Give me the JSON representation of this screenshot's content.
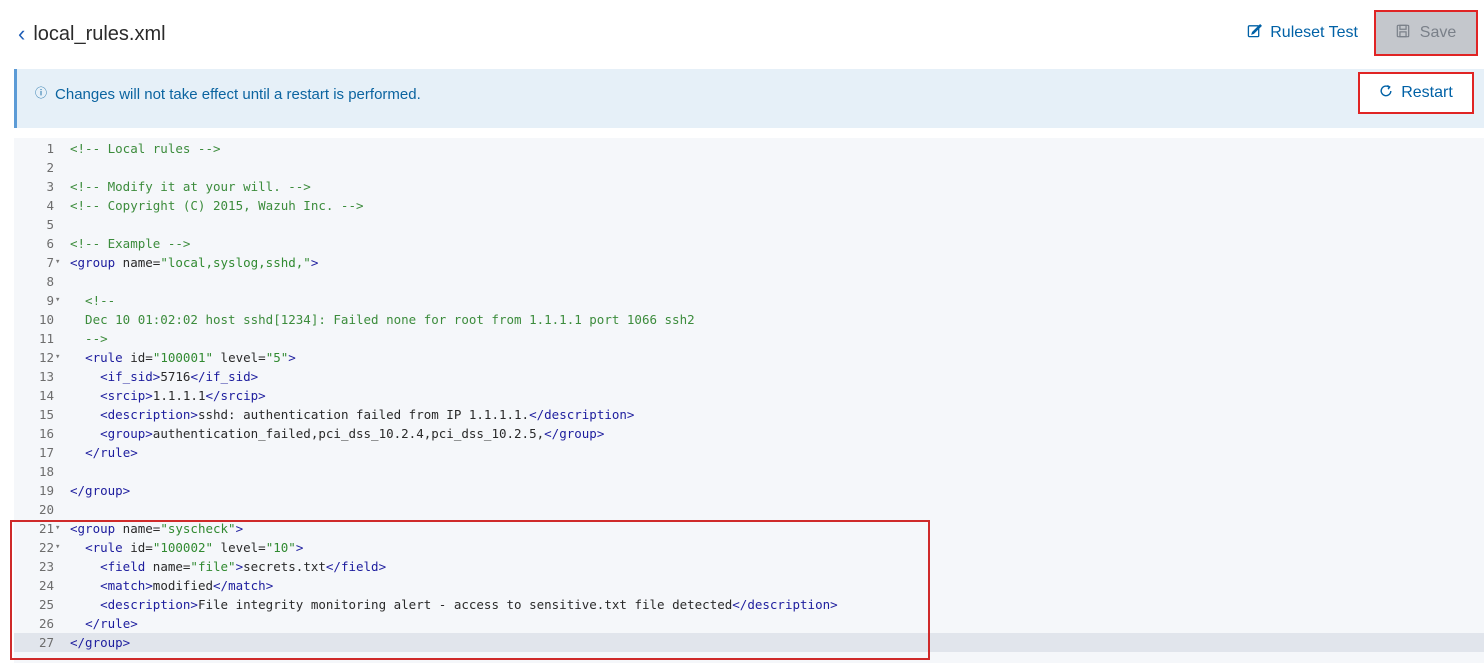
{
  "header": {
    "back_label": "local_rules.xml",
    "ruleset_test_label": "Ruleset Test",
    "save_label": "Save"
  },
  "callout": {
    "message": "Changes will not take effect until a restart is performed.",
    "restart_label": "Restart"
  },
  "icons": {
    "back": "chevron-left-icon",
    "ruleset_test": "edit-icon",
    "save": "save-icon",
    "info": "info-icon",
    "restart": "refresh-icon"
  },
  "colors": {
    "accent": "#0061a6",
    "callout_bg": "#e6f0f8",
    "highlight_border": "#cf2a2a",
    "editor_bg": "#f5f7fa",
    "comment": "#3c8c3c",
    "tag": "#1d1d9e",
    "string": "#318a31"
  },
  "editor": {
    "active_line": 27,
    "lines": [
      {
        "n": "1",
        "fold": false,
        "code": [
          {
            "t": "comment",
            "v": "<!-- Local rules -->"
          }
        ]
      },
      {
        "n": "2",
        "fold": false,
        "code": []
      },
      {
        "n": "3",
        "fold": false,
        "code": [
          {
            "t": "comment",
            "v": "<!-- Modify it at your will. -->"
          }
        ]
      },
      {
        "n": "4",
        "fold": false,
        "code": [
          {
            "t": "comment",
            "v": "<!-- Copyright (C) 2015, Wazuh Inc. -->"
          }
        ]
      },
      {
        "n": "5",
        "fold": false,
        "code": []
      },
      {
        "n": "6",
        "fold": false,
        "code": [
          {
            "t": "comment",
            "v": "<!-- Example -->"
          }
        ]
      },
      {
        "n": "7",
        "fold": true,
        "code": [
          {
            "t": "tag",
            "v": "<group"
          },
          {
            "t": "attr",
            "v": " name="
          },
          {
            "t": "str",
            "v": "\"local,syslog,sshd,\""
          },
          {
            "t": "tag",
            "v": ">"
          }
        ]
      },
      {
        "n": "8",
        "fold": false,
        "code": []
      },
      {
        "n": "9",
        "fold": true,
        "code": [
          {
            "t": "comment",
            "v": "  <!--"
          }
        ]
      },
      {
        "n": "10",
        "fold": false,
        "code": [
          {
            "t": "comment",
            "v": "  Dec 10 01:02:02 host sshd[1234]: Failed none for root from 1.1.1.1 port 1066 ssh2"
          }
        ]
      },
      {
        "n": "11",
        "fold": false,
        "code": [
          {
            "t": "comment",
            "v": "  -->"
          }
        ]
      },
      {
        "n": "12",
        "fold": true,
        "code": [
          {
            "t": "text",
            "v": "  "
          },
          {
            "t": "tag",
            "v": "<rule"
          },
          {
            "t": "attr",
            "v": " id="
          },
          {
            "t": "str",
            "v": "\"100001\""
          },
          {
            "t": "attr",
            "v": " level="
          },
          {
            "t": "str",
            "v": "\"5\""
          },
          {
            "t": "tag",
            "v": ">"
          }
        ]
      },
      {
        "n": "13",
        "fold": false,
        "code": [
          {
            "t": "text",
            "v": "    "
          },
          {
            "t": "tag",
            "v": "<if_sid>"
          },
          {
            "t": "text",
            "v": "5716"
          },
          {
            "t": "tag",
            "v": "</if_sid>"
          }
        ]
      },
      {
        "n": "14",
        "fold": false,
        "code": [
          {
            "t": "text",
            "v": "    "
          },
          {
            "t": "tag",
            "v": "<srcip>"
          },
          {
            "t": "text",
            "v": "1.1.1.1"
          },
          {
            "t": "tag",
            "v": "</srcip>"
          }
        ]
      },
      {
        "n": "15",
        "fold": false,
        "code": [
          {
            "t": "text",
            "v": "    "
          },
          {
            "t": "tag",
            "v": "<description>"
          },
          {
            "t": "text",
            "v": "sshd: authentication failed from IP 1.1.1.1."
          },
          {
            "t": "tag",
            "v": "</description>"
          }
        ]
      },
      {
        "n": "16",
        "fold": false,
        "code": [
          {
            "t": "text",
            "v": "    "
          },
          {
            "t": "tag",
            "v": "<group>"
          },
          {
            "t": "text",
            "v": "authentication_failed,pci_dss_10.2.4,pci_dss_10.2.5,"
          },
          {
            "t": "tag",
            "v": "</group>"
          }
        ]
      },
      {
        "n": "17",
        "fold": false,
        "code": [
          {
            "t": "text",
            "v": "  "
          },
          {
            "t": "tag",
            "v": "</rule>"
          }
        ]
      },
      {
        "n": "18",
        "fold": false,
        "code": []
      },
      {
        "n": "19",
        "fold": false,
        "code": [
          {
            "t": "tag",
            "v": "</group>"
          }
        ]
      },
      {
        "n": "20",
        "fold": false,
        "code": []
      },
      {
        "n": "21",
        "fold": true,
        "code": [
          {
            "t": "tag",
            "v": "<group"
          },
          {
            "t": "attr",
            "v": " name="
          },
          {
            "t": "str",
            "v": "\"syscheck\""
          },
          {
            "t": "tag",
            "v": ">"
          }
        ]
      },
      {
        "n": "22",
        "fold": true,
        "code": [
          {
            "t": "text",
            "v": "  "
          },
          {
            "t": "tag",
            "v": "<rule"
          },
          {
            "t": "attr",
            "v": " id="
          },
          {
            "t": "str",
            "v": "\"100002\""
          },
          {
            "t": "attr",
            "v": " level="
          },
          {
            "t": "str",
            "v": "\"10\""
          },
          {
            "t": "tag",
            "v": ">"
          }
        ]
      },
      {
        "n": "23",
        "fold": false,
        "code": [
          {
            "t": "text",
            "v": "    "
          },
          {
            "t": "tag",
            "v": "<field"
          },
          {
            "t": "attr",
            "v": " name="
          },
          {
            "t": "str",
            "v": "\"file\""
          },
          {
            "t": "tag",
            "v": ">"
          },
          {
            "t": "text",
            "v": "secrets.txt"
          },
          {
            "t": "tag",
            "v": "</field>"
          }
        ]
      },
      {
        "n": "24",
        "fold": false,
        "code": [
          {
            "t": "text",
            "v": "    "
          },
          {
            "t": "tag",
            "v": "<match>"
          },
          {
            "t": "text",
            "v": "modified"
          },
          {
            "t": "tag",
            "v": "</match>"
          }
        ]
      },
      {
        "n": "25",
        "fold": false,
        "code": [
          {
            "t": "text",
            "v": "    "
          },
          {
            "t": "tag",
            "v": "<description>"
          },
          {
            "t": "text",
            "v": "File integrity monitoring alert - access to sensitive.txt file detected"
          },
          {
            "t": "tag",
            "v": "</description>"
          }
        ]
      },
      {
        "n": "26",
        "fold": false,
        "code": [
          {
            "t": "text",
            "v": "  "
          },
          {
            "t": "tag",
            "v": "</rule>"
          }
        ]
      },
      {
        "n": "27",
        "fold": false,
        "code": [
          {
            "t": "tag",
            "v": "</group>"
          }
        ]
      }
    ]
  }
}
